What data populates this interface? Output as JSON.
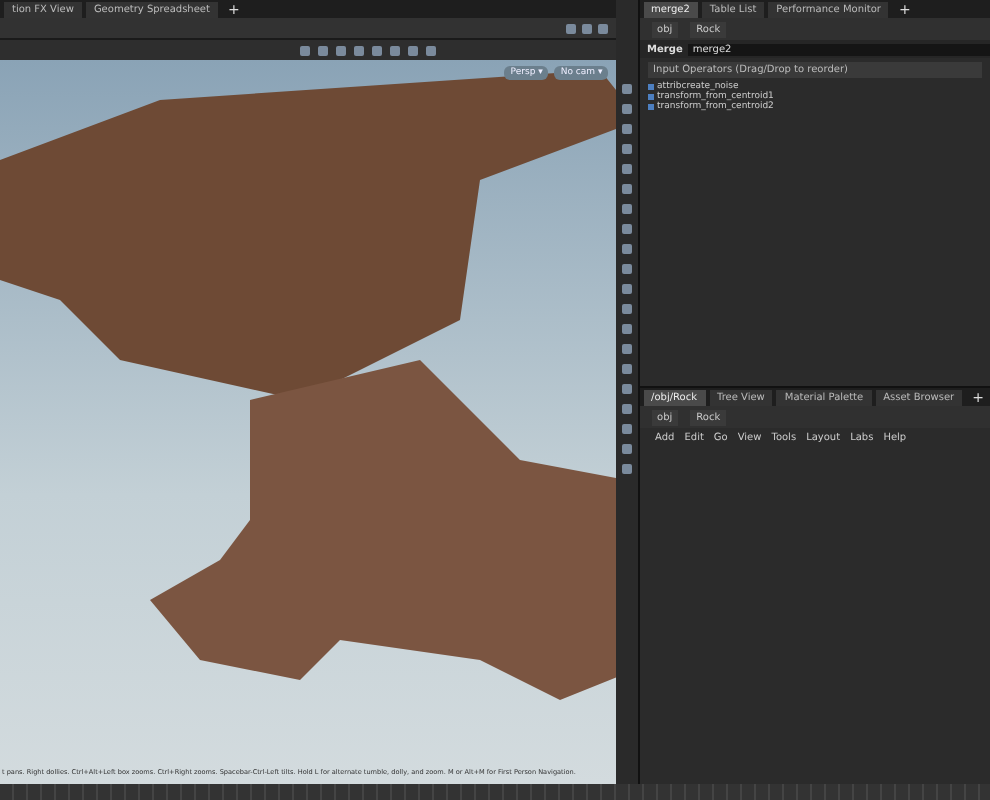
{
  "viewer_tabs": [
    {
      "label": "tion FX View",
      "selected": false
    },
    {
      "label": "Geometry Spreadsheet",
      "selected": false
    }
  ],
  "add_tab": "+",
  "viewport": {
    "camera_menus": [
      "Persp ▾",
      "No cam ▾"
    ],
    "hint": "t pans. Right dollies. Ctrl+Alt+Left box zooms. Ctrl+Right zooms. Spacebar-Ctrl-Left tilts. Hold L for alternate tumble, dolly, and zoom. M or Alt+M for First Person Navigation."
  },
  "parameter_pane": {
    "tabs": [
      {
        "label": "merge2",
        "selected": true
      },
      {
        "label": "Table List",
        "selected": false
      },
      {
        "label": "Performance Monitor",
        "selected": false
      }
    ],
    "add_tab": "+",
    "path": [
      "obj",
      "Rock"
    ],
    "node_type": "Merge",
    "node_name": "merge2",
    "inputs_header": "Input Operators (Drag/Drop to reorder)",
    "inputs": [
      "attribcreate_noise",
      "transform_from_centroid1",
      "transform_from_centroid2"
    ]
  },
  "network_pane": {
    "tabs": [
      {
        "label": "/obj/Rock",
        "selected": true
      },
      {
        "label": "Tree View",
        "selected": false
      },
      {
        "label": "Material Palette",
        "selected": false
      },
      {
        "label": "Asset Browser",
        "selected": false
      }
    ],
    "add_tab": "+",
    "path": [
      "obj",
      "Rock"
    ],
    "menu": [
      "Add",
      "Edit",
      "Go",
      "View",
      "Tools",
      "Layout",
      "Labs",
      "Help"
    ]
  }
}
